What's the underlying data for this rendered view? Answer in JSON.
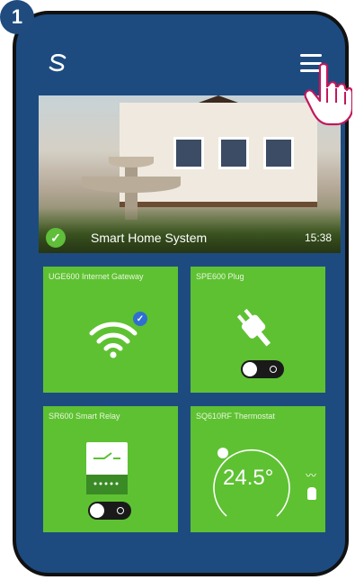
{
  "step": {
    "number": "1"
  },
  "topbar": {
    "logo_icon": "salus-logo-icon",
    "menu_icon": "hamburger-menu-icon"
  },
  "hero": {
    "title": "Smart Home System",
    "time": "15:38",
    "status_icon": "check-circle-icon"
  },
  "tiles": [
    {
      "label": "UGE600 Internet Gateway",
      "icon": "wifi-icon"
    },
    {
      "label": "SPE600 Plug",
      "icon": "plug-icon"
    },
    {
      "label": "SR600 Smart Relay",
      "icon": "relay-icon"
    },
    {
      "label": "SQ610RF Thermostat",
      "icon": "thermostat-icon",
      "temperature": "24.5°"
    }
  ],
  "colors": {
    "phone_bg": "#1d4b80",
    "tile_bg": "#5ec132",
    "badge_bg": "#1f4b7f"
  }
}
